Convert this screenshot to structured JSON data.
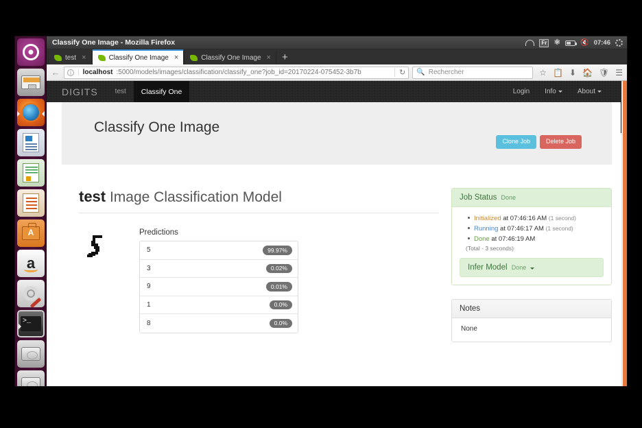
{
  "window": {
    "title": "Classify One Image - Mozilla Firefox"
  },
  "tray": {
    "keyboard_layout": "Fr",
    "clock": "07:46",
    "icons": [
      "wifi-icon",
      "keyboard-layout-icon",
      "bluetooth-icon",
      "battery-icon",
      "volume-muted-icon",
      "system-menu-icon"
    ]
  },
  "tabs": [
    {
      "label": "test",
      "active": false,
      "close": "×"
    },
    {
      "label": "Classify One Image",
      "active": true,
      "close": "×"
    },
    {
      "label": "Classify One Image",
      "active": false,
      "close": "×"
    }
  ],
  "newtab_label": "+",
  "navbar": {
    "back": "←",
    "url_host": "localhost",
    "url_rest": ":5000/models/images/classification/classify_one?job_id=20170224-075452-3b7b",
    "reload": "↻",
    "search_placeholder": "Rechercher",
    "icons": [
      "bookmark-star-icon",
      "reading-list-icon",
      "downloads-icon",
      "home-icon",
      "pocket-icon",
      "menu-icon"
    ]
  },
  "app_nav": {
    "brand": "DIGITS",
    "items": [
      {
        "label": "test",
        "selected": false
      },
      {
        "label": "Classify One",
        "selected": true
      }
    ],
    "right_items": [
      {
        "label": "Login",
        "caret": false
      },
      {
        "label": "Info",
        "caret": true
      },
      {
        "label": "About",
        "caret": true
      }
    ]
  },
  "jumbotron": {
    "heading": "Classify One Image",
    "clone_button": "Clone Job",
    "delete_button": "Delete Job"
  },
  "model": {
    "name": "test",
    "subtitle": "Image Classification Model"
  },
  "predictions": {
    "label": "Predictions",
    "rows": [
      {
        "class": "5",
        "confidence": "99.97%"
      },
      {
        "class": "3",
        "confidence": "0.02%"
      },
      {
        "class": "9",
        "confidence": "0.01%"
      },
      {
        "class": "1",
        "confidence": "0.0%"
      },
      {
        "class": "8",
        "confidence": "0.0%"
      }
    ]
  },
  "job_status": {
    "title": "Job Status",
    "state": "Done",
    "steps": [
      {
        "name": "Initialized",
        "at": "at 07:46:16 AM",
        "duration": "(1 second)"
      },
      {
        "name": "Running",
        "at": "at 07:46:17 AM",
        "duration": "(1 second)"
      },
      {
        "name": "Done",
        "at": "at 07:46:19 AM",
        "duration": ""
      }
    ],
    "total": "(Total - 3 seconds)",
    "infer_model": {
      "label": "Infer Model",
      "state": "Done"
    }
  },
  "notes": {
    "title": "Notes",
    "body": "None"
  },
  "colors": {
    "clone_button": "#5bc0de",
    "delete_button": "#d9655f",
    "badge": "#717171",
    "panel_green": "#dff0d8",
    "scrollbar": "#e8793c",
    "status_initialized": "#c88a3a",
    "status_running": "#4a83c4",
    "status_done": "#6a9e4a"
  },
  "launcher": {
    "items": [
      "ubuntu-dash-icon",
      "files-icon",
      "firefox-icon",
      "libreoffice-writer-icon",
      "libreoffice-calc-icon",
      "libreoffice-impress-icon",
      "software-center-icon",
      "amazon-icon",
      "system-settings-icon",
      "terminal-icon",
      "disk-drive-icon",
      "disk-drive-icon-2",
      "cd-drive-icon"
    ]
  }
}
